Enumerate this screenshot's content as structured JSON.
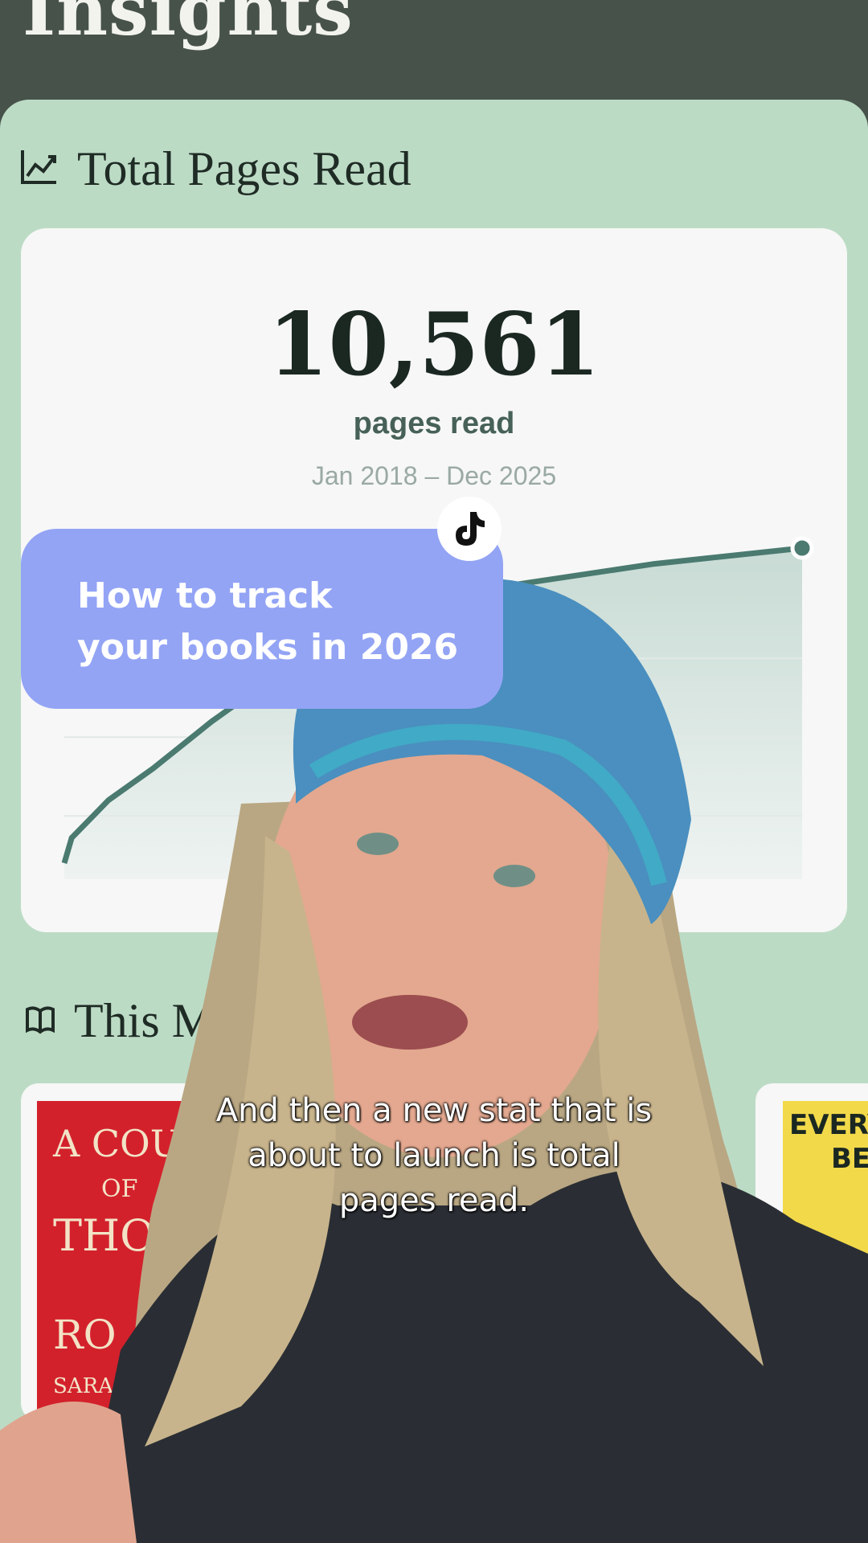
{
  "header": {
    "title": "Insights"
  },
  "pages_section": {
    "title": "Total Pages Read",
    "icon": "trend-chart-icon",
    "total": "10,561",
    "unit_label": "pages read",
    "date_range": "Jan 2018 – Dec 2025"
  },
  "chart_data": {
    "type": "area",
    "x": [
      "Jan 2018",
      "Dec 2025"
    ],
    "values": [
      0,
      10561
    ],
    "title": "",
    "xlabel": "",
    "ylabel": ""
  },
  "month_section": {
    "title": "This Mo",
    "icon": "book-icon"
  },
  "books": [
    {
      "cover_text": [
        "A COU",
        "OF",
        "THO",
        "RO",
        "SARA"
      ],
      "color": "#d3212c"
    },
    {
      "cover_text": [
        "EVERY",
        "BEE"
      ],
      "color": "#f2d94a"
    }
  ],
  "overlay": {
    "bubble_line1": "How to track",
    "bubble_line2": "your books in 2026",
    "caption_line1": "And then a new stat that is",
    "caption_line2": "about to launch is total",
    "caption_line3": "pages read."
  },
  "colors": {
    "header_bg": "#47524b",
    "panel_bg": "#bcdbc5",
    "accent": "#4a7a70",
    "bubble": "#93a4f5"
  }
}
